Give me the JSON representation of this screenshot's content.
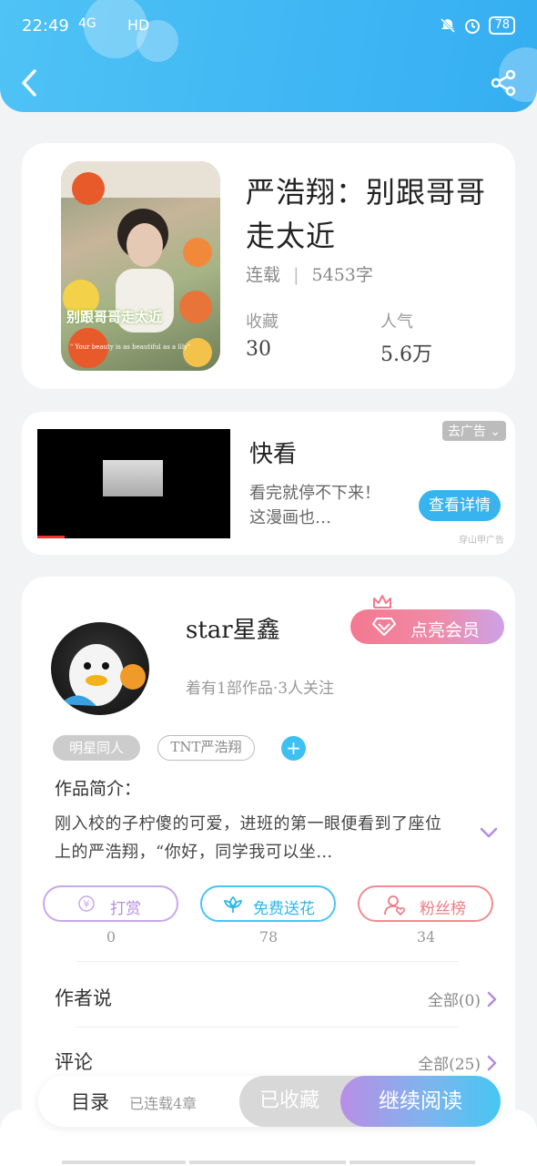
{
  "status_bar": {
    "time": "22:49",
    "network": "4G",
    "hd": "HD",
    "battery": "78"
  },
  "book": {
    "title": "严浩翔：别跟哥哥走太近",
    "status": "连载",
    "word_count": "5453字",
    "favorites_label": "收藏",
    "favorites_value": "30",
    "popularity_label": "人气",
    "popularity_value": "5.6万",
    "cover_text": "别跟哥哥走太近",
    "cover_caption": "\" Your beauty is as beautiful as a lily\""
  },
  "ad": {
    "title": "快看",
    "description": "看完就停不下来！这漫画也…",
    "remove_label": "去广告",
    "cta_label": "查看详情",
    "source": "穿山甲广告"
  },
  "author": {
    "name": "star星鑫",
    "meta": "着有1部作品·3人关注",
    "vip_label": "点亮会员",
    "tags": [
      "明星同人",
      "TNT严浩翔"
    ],
    "intro_label": "作品简介：",
    "intro_text": "刚入校的子柠傻的可爱，进班的第一眼便看到了座位上的严浩翔，“你好，同学我可以坐…"
  },
  "actions": [
    {
      "label": "打赏",
      "count": "0",
      "icon": "yen-coin-icon"
    },
    {
      "label": "免费送花",
      "count": "78",
      "icon": "flower-icon"
    },
    {
      "label": "粉丝榜",
      "count": "34",
      "icon": "fan-ranking-icon"
    }
  ],
  "sections": {
    "author_says": {
      "title": "作者说",
      "link": "全部(0)"
    },
    "comments": {
      "title": "评论",
      "link": "全部(25)"
    }
  },
  "bottom_bar": {
    "toc_label": "目录",
    "toc_status": "已连载4章",
    "favorite_label": "已收藏",
    "read_label": "继续阅读"
  },
  "colors": {
    "header": "#3fb6f4",
    "accent_blue": "#3ec0f2",
    "vip_pink": "#f47891",
    "reward_purple": "#b48ce0",
    "fans_red": "#ea7c86"
  }
}
